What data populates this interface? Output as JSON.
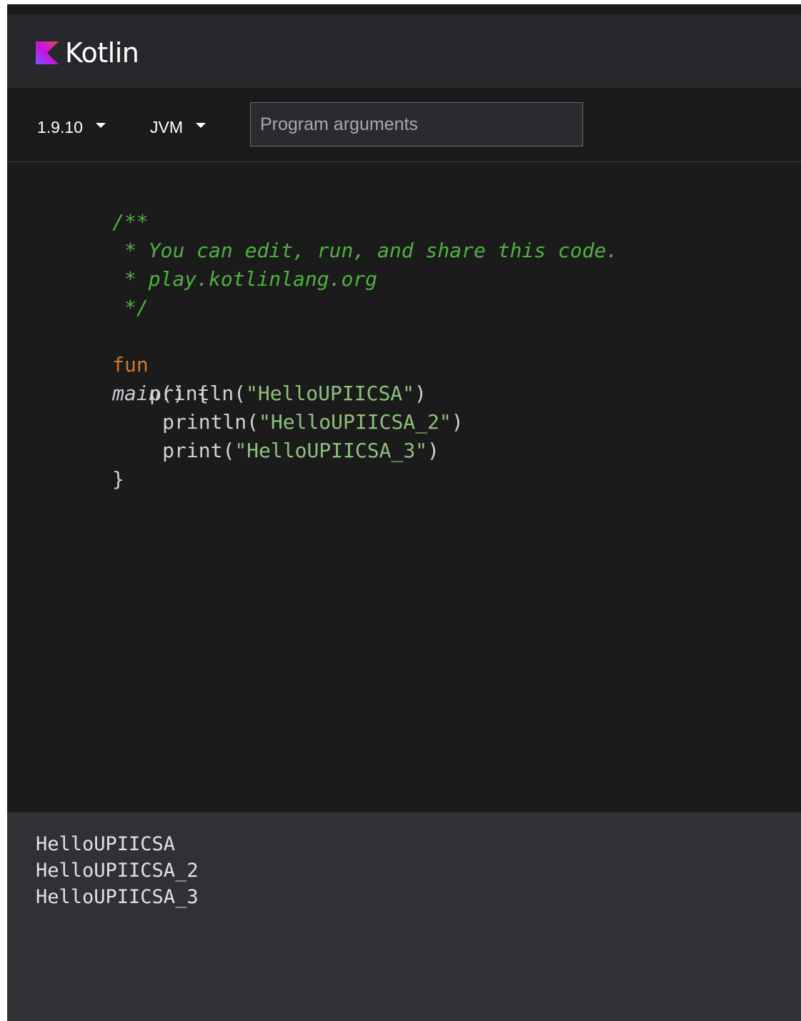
{
  "header": {
    "logo_text": "Kotlin",
    "logo_icon": "kotlin-logo-icon"
  },
  "toolbar": {
    "version_label": "1.9.10",
    "target_label": "JVM",
    "args_placeholder": "Program arguments",
    "args_value": ""
  },
  "editor": {
    "lines": {
      "l1": {
        "comment": "/**"
      },
      "l2": {
        "comment": " * You can edit, run, and share this code."
      },
      "l3": {
        "comment": " * play.kotlinlang.org"
      },
      "l4": {
        "comment": " */"
      },
      "l5": {
        "kw": "fun",
        "name": "main",
        "rest": "() {"
      },
      "l6": {
        "call": "println(",
        "str": "\"HelloUPIICSA\"",
        "close": ")"
      },
      "l7": {
        "call": "println(",
        "str": "\"HelloUPIICSA_2\"",
        "close": ")"
      },
      "l8": {
        "call": "print(",
        "str": "\"HelloUPIICSA_3\"",
        "close": ")"
      },
      "l9": {
        "text": "}"
      }
    }
  },
  "output": {
    "lines": [
      "HelloUPIICSA",
      "HelloUPIICSA_2",
      "HelloUPIICSA_3"
    ]
  },
  "colors": {
    "header_bg": "#27282c",
    "editor_bg": "#1b1b1c",
    "output_bg": "#303035",
    "comment": "#4fb140",
    "keyword": "#cc7832",
    "string": "#8ec07c"
  }
}
